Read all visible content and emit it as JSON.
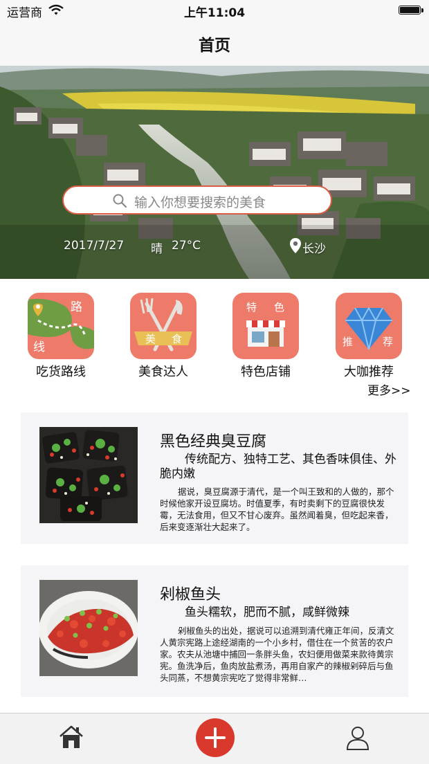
{
  "status_bar": {
    "carrier": "运营商",
    "time": "上午11:04"
  },
  "nav": {
    "title": "首页"
  },
  "hero": {
    "search_placeholder": "输入你想要搜索的美食",
    "date": "2017/7/27",
    "weather": "晴",
    "temperature": "27°C",
    "city": "长沙"
  },
  "categories": [
    {
      "label": "吃货路线",
      "icon_text_1": "路",
      "icon_text_2": "线"
    },
    {
      "label": "美食达人",
      "icon_text_1": "美",
      "icon_text_2": "食"
    },
    {
      "label": "特色店铺",
      "icon_text_1": "特",
      "icon_text_2": "色"
    },
    {
      "label": "大咖推荐",
      "icon_text_1": "推",
      "icon_text_2": "荐"
    }
  ],
  "more_label": "更多>>",
  "dishes": [
    {
      "title": "黑色经典臭豆腐",
      "subtitle": "传统配方、独特工艺、其色香味俱佳、外脆内嫩",
      "description": "据说，臭豆腐源于清代，是一个叫王致和的人做的，那个时候他家开设豆腐坊。时值夏季，有时卖剩下的豆腐很快发霉，无法食用，但又不甘心废弃。虽然闻着臭，但吃起来香，后来变逐渐壮大起来了。"
    },
    {
      "title": "剁椒鱼头",
      "subtitle": "鱼头糯软，肥而不腻，咸鲜微辣",
      "description": "剁椒鱼头的出处，据说可以追溯到清代雍正年间，反清文人黄宗宪路上途经湖南的一个小乡村，借住在一个贫苦的农户家。农夫从池塘中捕回一条胖头鱼，农妇便用做菜来款待黄宗宪。鱼洗净后，鱼肉放盐煮汤，再用自家产的辣椒剁碎后与鱼头同蒸，不想黄宗宪吃了觉得非常鲜…"
    }
  ],
  "colors": {
    "accent": "#d9392c",
    "icon_bg": "#ee7b6a",
    "search_border": "#d95c43"
  },
  "tab_icons": [
    "home-icon",
    "add-icon",
    "user-icon"
  ]
}
